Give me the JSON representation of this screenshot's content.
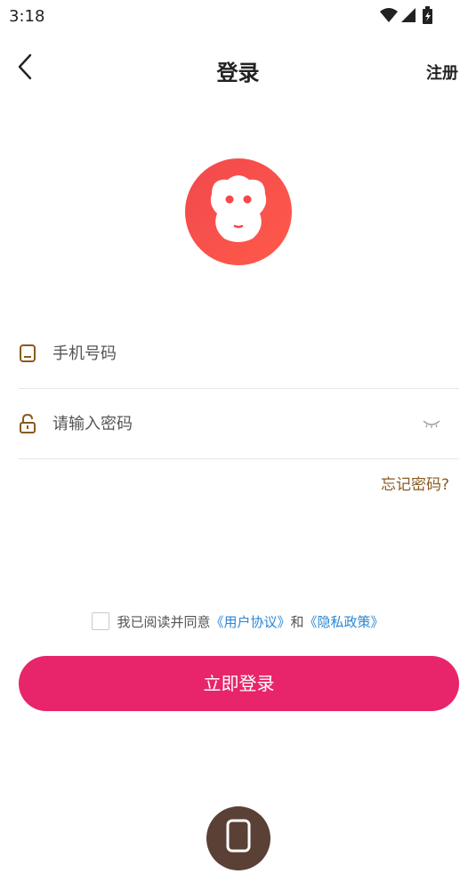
{
  "status_bar": {
    "time": "3:18",
    "icons": [
      "wifi-icon",
      "signal-icon",
      "battery-icon"
    ]
  },
  "nav": {
    "title": "登录",
    "register_label": "注册",
    "back_icon": "back-chevron-icon"
  },
  "logo": {
    "icon": "monkey-logo-icon",
    "color": "#f5474c"
  },
  "form": {
    "phone": {
      "placeholder": "手机号码",
      "value": "",
      "icon": "phone-icon"
    },
    "password": {
      "placeholder": "请输入密码",
      "value": "",
      "icon": "lock-icon",
      "toggle_icon": "eye-closed-icon"
    },
    "forgot_label": "忘记密码?"
  },
  "agreement": {
    "prefix": "我已阅读并同意",
    "user_agreement": "《用户协议》",
    "and": "和",
    "privacy_policy": "《隐私政策》",
    "checked": false
  },
  "login_button": {
    "label": "立即登录",
    "color": "#e8256a"
  },
  "alt_login": {
    "icon": "phone-login-icon",
    "color": "#5a4035"
  },
  "colors": {
    "accent": "#e8256a",
    "link": "#2a87d6",
    "forgot": "#8a5a1e"
  }
}
